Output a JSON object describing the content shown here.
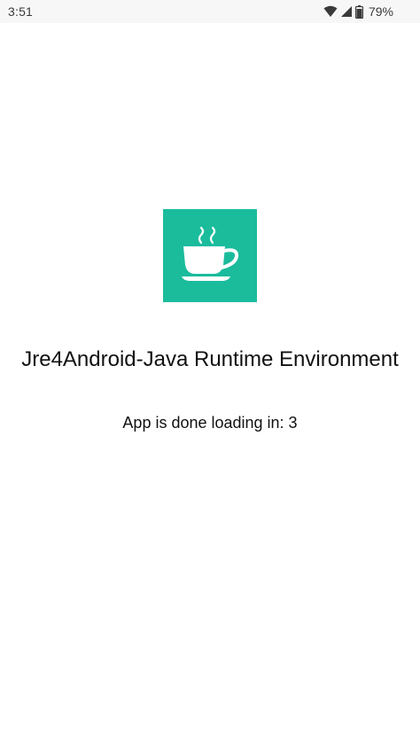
{
  "status_bar": {
    "time": "3:51",
    "battery_percent": "79%",
    "icons": [
      "wifi-icon",
      "cellular-signal-icon",
      "battery-icon"
    ]
  },
  "splash": {
    "logo_icon": "coffee-cup-icon",
    "logo_background": "#1abc9c",
    "title": "Jre4Android-Java Runtime Environment",
    "loading_message": "App is done loading in: 3"
  }
}
